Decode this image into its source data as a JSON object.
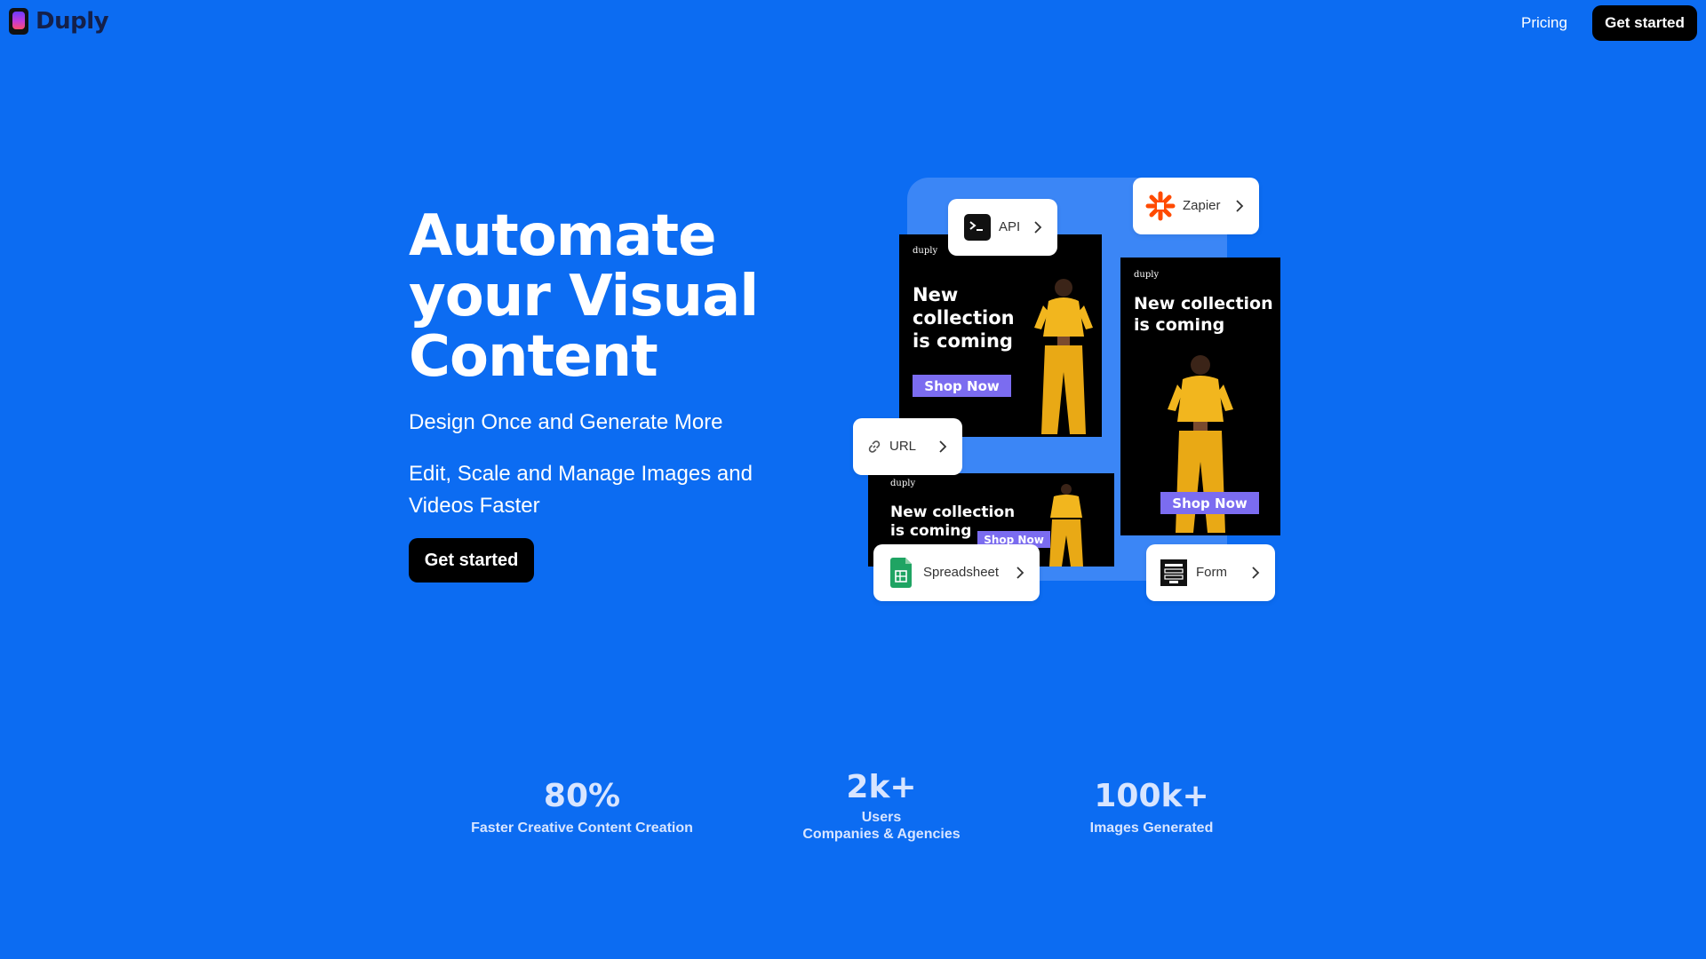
{
  "nav": {
    "brand": "Duply",
    "pricing": "Pricing",
    "cta": "Get started"
  },
  "hero": {
    "title_lines": [
      "Automate",
      "your Visual",
      "Content"
    ],
    "subtitle": "Design Once and Generate More",
    "description": "Edit, Scale and Manage Images and Videos Faster",
    "cta": "Get started"
  },
  "illustration": {
    "ads": [
      {
        "brand": "duply",
        "headline": "New collection is coming",
        "button": "Shop Now"
      },
      {
        "brand": "duply",
        "headline": "New collection is coming",
        "button": "Shop Now"
      },
      {
        "brand": "duply",
        "headline": "New collection is coming",
        "button": "Shop Now"
      }
    ],
    "chips": {
      "api": "API",
      "zapier": "Zapier",
      "url": "URL",
      "spreadsheet": "Spreadsheet",
      "form": "Form"
    }
  },
  "stats": [
    {
      "value": "80%",
      "label": "Faster Creative Content Creation"
    },
    {
      "value": "2k+",
      "label_line1": "Users",
      "label_line2": "Companies & Agencies"
    },
    {
      "value": "100k+",
      "label": "Images Generated"
    }
  ],
  "colors": {
    "background": "#0C6CF2",
    "accent": "#7B6CF0",
    "dark": "#000000",
    "zapier": "#FF4A00",
    "sheets": "#1FA463"
  }
}
